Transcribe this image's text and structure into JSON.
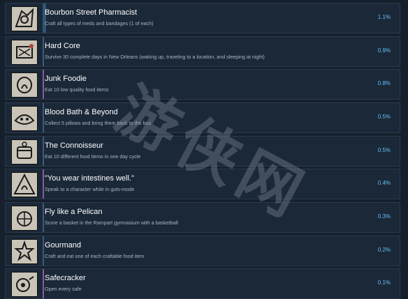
{
  "achievements": [
    {
      "title": "Bourbon Street Pharmacist",
      "description": "Craft all types of meds and bandages (1 of each)",
      "percent": "1.1%",
      "icon": "pharmacist-achievement-icon"
    },
    {
      "title": "Hard Core",
      "description": "Survive 30 complete days in New Orleans (waking up, traveling to a location, and sleeping at night)",
      "percent": "0.9%",
      "icon": "hard-core-achievement-icon"
    },
    {
      "title": "Junk Foodie",
      "description": "Eat 10 low quality food items",
      "percent": "0.8%",
      "icon": "junk-foodie-achievement-icon"
    },
    {
      "title": "Blood Bath & Beyond",
      "description": "Collect 5 pillows and bring them back to the bus",
      "percent": "0.5%",
      "icon": "blood-bath-achievement-icon"
    },
    {
      "title": "The Connoisseur",
      "description": "Eat 10 different food items in one day cycle",
      "percent": "0.5%",
      "icon": "connoisseur-achievement-icon"
    },
    {
      "title": "\"You wear intestines well.\"",
      "description": "Speak to a character while in guts-mode",
      "percent": "0.4%",
      "icon": "intestines-achievement-icon"
    },
    {
      "title": "Fly like a Pelican",
      "description": "Score a basket in the Rampart gymnasium with a basketball",
      "percent": "0.3%",
      "icon": "pelican-achievement-icon"
    },
    {
      "title": "Gourmand",
      "description": "Craft and eat one of each craftable food item",
      "percent": "0.2%",
      "icon": "gourmand-achievement-icon"
    },
    {
      "title": "Safecracker",
      "description": "Open every safe",
      "percent": "0.1%",
      "icon": "safecracker-achievement-icon"
    }
  ],
  "watermark": "游侠网",
  "colors": {
    "background": "#16202d",
    "row": "#1b2838",
    "percent": "#66c0f4",
    "title": "#ffffff",
    "description": "#aab5c2"
  }
}
